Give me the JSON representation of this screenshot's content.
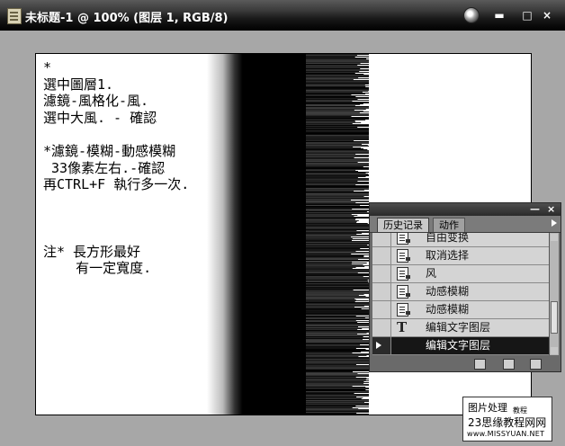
{
  "window": {
    "title": "未标题-1 @ 100% (图层 1, RGB/8)",
    "controls": {
      "minimize": "▬",
      "maximize": "□",
      "close": "×"
    }
  },
  "canvas": {
    "text_lines": [
      "*",
      "選中圖層1.",
      "濾鏡-風格化-風.",
      "選中大風. - 確認",
      "",
      "*濾鏡-模糊-動感模糊",
      " 33像素左右.-確認",
      "再CTRL+F 執行多一次.",
      "",
      "",
      "",
      "注* 長方形最好",
      "    有一定寬度."
    ]
  },
  "history_panel": {
    "top_controls": {
      "minimize": "—",
      "close": "×"
    },
    "tabs": [
      {
        "label": "历史记录",
        "active": true
      },
      {
        "label": "动作",
        "active": false
      }
    ],
    "items": [
      {
        "label": "自由变换",
        "icon": "history-step-icon",
        "selected": false
      },
      {
        "label": "取消选择",
        "icon": "history-step-icon",
        "selected": false
      },
      {
        "label": "风",
        "icon": "history-step-icon",
        "selected": false
      },
      {
        "label": "动感模糊",
        "icon": "history-step-icon",
        "selected": false
      },
      {
        "label": "动感模糊",
        "icon": "history-step-icon",
        "selected": false
      },
      {
        "label": "编辑文字图层",
        "icon": "type-tool-icon",
        "selected": false
      },
      {
        "label": "编辑文字图层",
        "icon": "history-marker-icon",
        "selected": true
      }
    ]
  },
  "watermark": {
    "line1": "图片处理",
    "line2": "教程",
    "line3": "23思缘教程网网",
    "line4": "www.MISSYUAN.NET"
  }
}
